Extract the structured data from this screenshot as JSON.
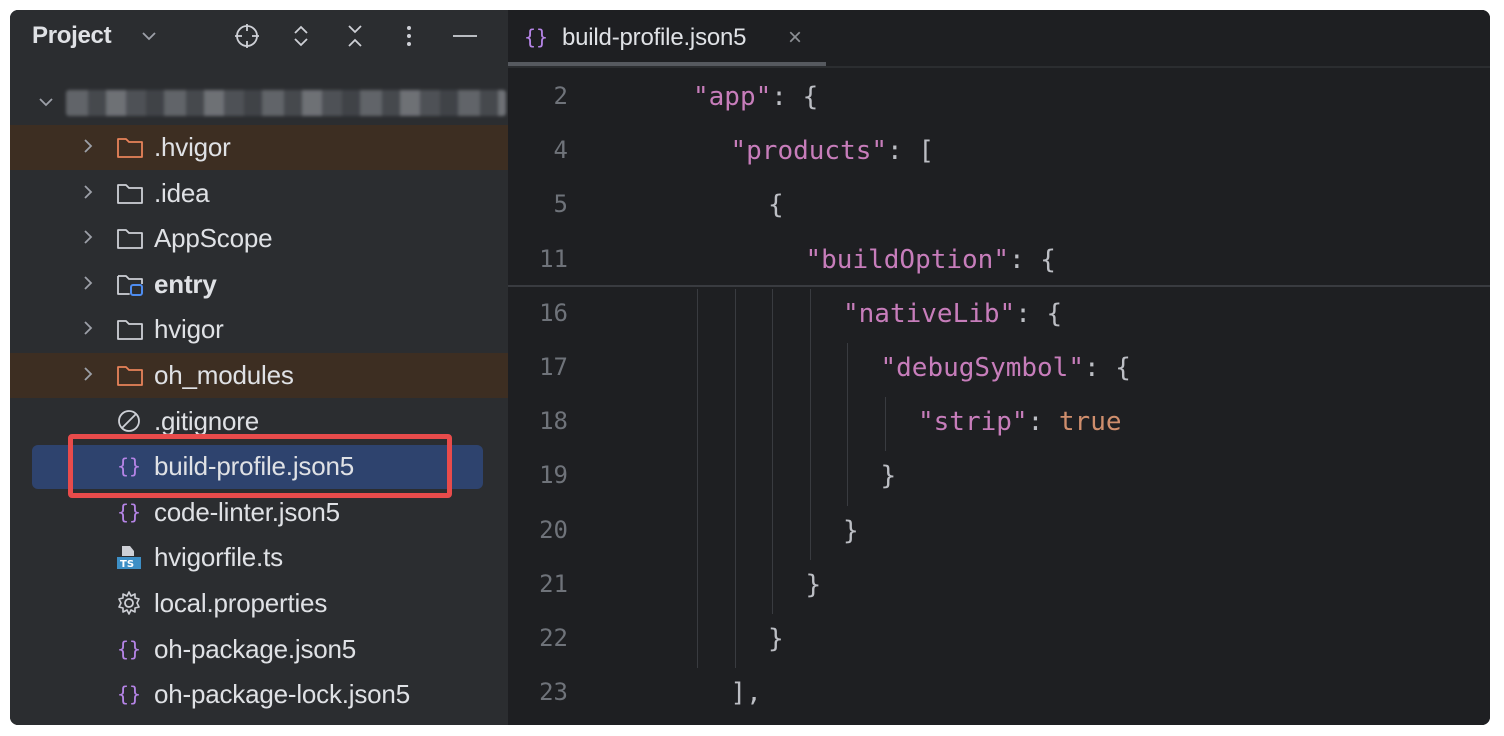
{
  "project_panel": {
    "title": "Project",
    "header_icons": [
      "caret-down-icon",
      "locate-icon",
      "expand-collapse-icon",
      "collapse-all-icon",
      "more-options-icon",
      "hide-panel-icon"
    ],
    "tree": [
      {
        "label": ".hvigor",
        "type": "folder",
        "expandable": true,
        "highlight": true,
        "icon_color": "#e8825a"
      },
      {
        "label": ".idea",
        "type": "folder",
        "expandable": true
      },
      {
        "label": "AppScope",
        "type": "folder",
        "expandable": true
      },
      {
        "label": "entry",
        "type": "module-folder",
        "expandable": true,
        "bold": true
      },
      {
        "label": "hvigor",
        "type": "folder",
        "expandable": true
      },
      {
        "label": "oh_modules",
        "type": "folder",
        "expandable": true,
        "highlight": true,
        "icon_color": "#e8825a"
      },
      {
        "label": ".gitignore",
        "type": "ignored-file"
      },
      {
        "label": "build-profile.json5",
        "type": "json-file",
        "selected": true
      },
      {
        "label": "code-linter.json5",
        "type": "json-file"
      },
      {
        "label": "hvigorfile.ts",
        "type": "ts-file"
      },
      {
        "label": "local.properties",
        "type": "properties-file"
      },
      {
        "label": "oh-package.json5",
        "type": "json-file"
      },
      {
        "label": "oh-package-lock.json5",
        "type": "json-file"
      }
    ]
  },
  "editor": {
    "tab": {
      "label": "build-profile.json5",
      "close": "×"
    },
    "lines": [
      {
        "num": "2",
        "indent": 2,
        "tokens": [
          {
            "t": "\"app\"",
            "c": "k"
          },
          {
            "t": ": {",
            "c": "p"
          }
        ]
      },
      {
        "num": "4",
        "indent": 3,
        "tokens": [
          {
            "t": "\"products\"",
            "c": "k"
          },
          {
            "t": ": [",
            "c": "p"
          }
        ]
      },
      {
        "num": "5",
        "indent": 4,
        "tokens": [
          {
            "t": "{",
            "c": "p"
          }
        ]
      },
      {
        "num": "11",
        "indent": 5,
        "tokens": [
          {
            "t": "\"buildOption\"",
            "c": "k"
          },
          {
            "t": ": {",
            "c": "p"
          }
        ]
      },
      {
        "num": "16",
        "indent": 6,
        "tokens": [
          {
            "t": "\"nativeLib\"",
            "c": "k"
          },
          {
            "t": ": {",
            "c": "p"
          }
        ]
      },
      {
        "num": "17",
        "indent": 7,
        "tokens": [
          {
            "t": "\"debugSymbol\"",
            "c": "k"
          },
          {
            "t": ": {",
            "c": "p"
          }
        ]
      },
      {
        "num": "18",
        "indent": 8,
        "tokens": [
          {
            "t": "\"strip\"",
            "c": "k"
          },
          {
            "t": ": ",
            "c": "p"
          },
          {
            "t": "true",
            "c": "b"
          }
        ]
      },
      {
        "num": "19",
        "indent": 7,
        "tokens": [
          {
            "t": "}",
            "c": "p"
          }
        ]
      },
      {
        "num": "20",
        "indent": 6,
        "tokens": [
          {
            "t": "}",
            "c": "p"
          }
        ]
      },
      {
        "num": "21",
        "indent": 5,
        "tokens": [
          {
            "t": "}",
            "c": "p"
          }
        ]
      },
      {
        "num": "22",
        "indent": 4,
        "tokens": [
          {
            "t": "}",
            "c": "p"
          }
        ]
      },
      {
        "num": "23",
        "indent": 3,
        "tokens": [
          {
            "t": "],",
            "c": "p"
          }
        ]
      }
    ]
  },
  "colors": {
    "key": "#c77dbb",
    "boolean": "#cf8e6d",
    "punctuation": "#bcbec4",
    "line_number": "#6f737a",
    "selection": "#2e436e",
    "annotation_box": "#e84b4b"
  }
}
